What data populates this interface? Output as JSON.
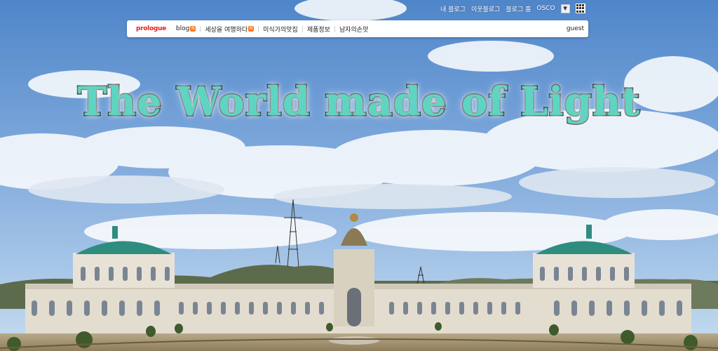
{
  "util": {
    "links": [
      "내 블로그",
      "이웃블로그",
      "블로그 홈",
      "OSCO"
    ],
    "dropdown_icon": "triangle-down-icon",
    "apps_icon": "grid-icon"
  },
  "nav": {
    "brand": "prologue",
    "items": [
      {
        "label": "blog",
        "badge": "N"
      },
      {
        "label": "세상을 여행하다",
        "badge": "N"
      },
      {
        "label": "미식가의맛집",
        "badge": ""
      },
      {
        "label": "제품정보",
        "badge": ""
      },
      {
        "label": "남자의손맛",
        "badge": ""
      }
    ],
    "user": "guest"
  },
  "hero": {
    "title": "The World made of Light"
  },
  "colors": {
    "sky_top": "#4f86c9",
    "sky_bottom": "#c6dcf0",
    "title_fill": "#5ed5c2",
    "title_stroke": "#111111",
    "brand": "#e2231a",
    "badge": "#ff7a22",
    "roof": "#2e8d7f"
  }
}
